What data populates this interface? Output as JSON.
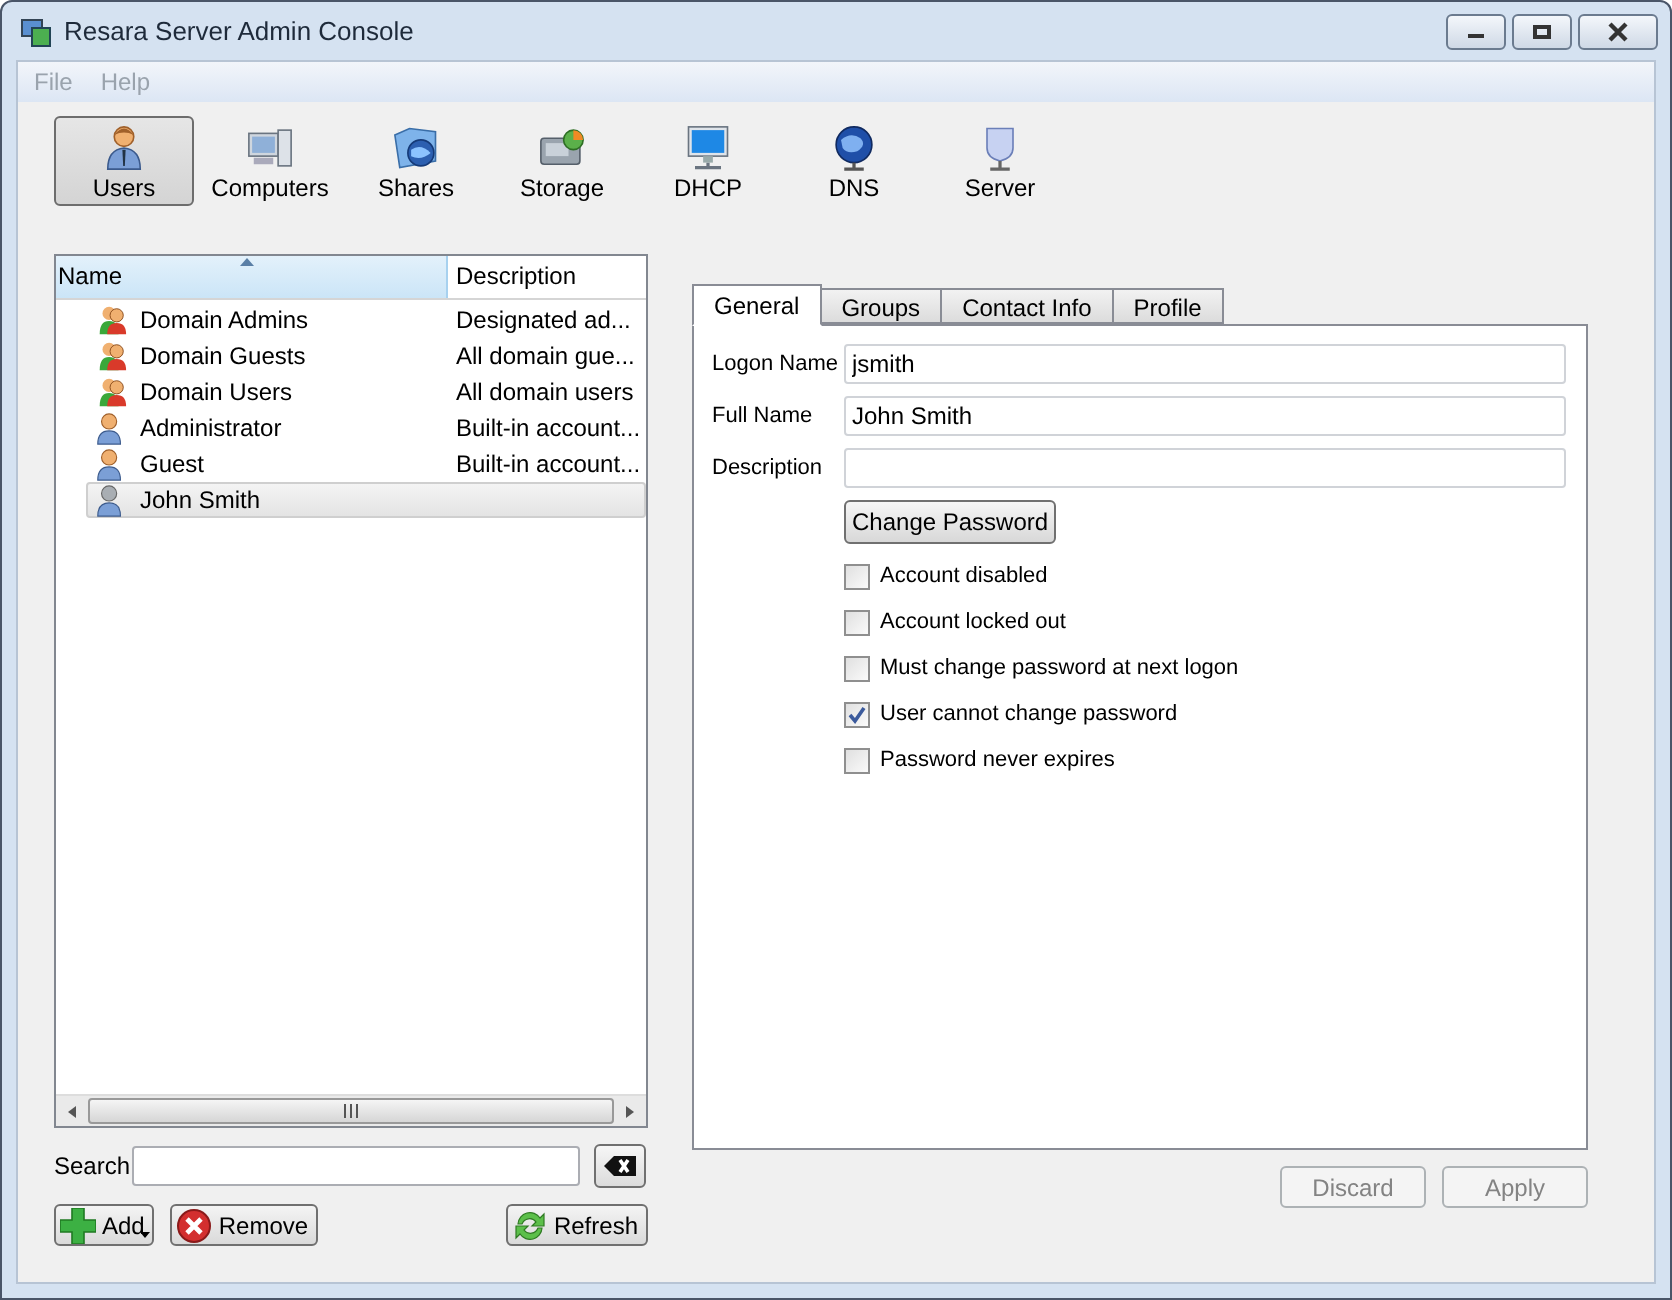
{
  "window": {
    "title": "Resara Server Admin Console"
  },
  "menu": [
    {
      "label": "File",
      "disabled": true
    },
    {
      "label": "Help",
      "disabled": true
    }
  ],
  "toolbar": [
    {
      "label": "Users",
      "kind": "users",
      "selected": true
    },
    {
      "label": "Computers",
      "kind": "computers",
      "selected": false
    },
    {
      "label": "Shares",
      "kind": "shares",
      "selected": false
    },
    {
      "label": "Storage",
      "kind": "storage",
      "selected": false
    },
    {
      "label": "DHCP",
      "kind": "dhcp",
      "selected": false
    },
    {
      "label": "DNS",
      "kind": "dns",
      "selected": false
    },
    {
      "label": "Server",
      "kind": "server",
      "selected": false
    }
  ],
  "list": {
    "columns": [
      "Name",
      "Description"
    ],
    "rows": [
      {
        "name": "Domain Admins",
        "description": "Designated ad...",
        "kind": "group",
        "selected": false
      },
      {
        "name": "Domain Guests",
        "description": "All domain gue...",
        "kind": "group",
        "selected": false
      },
      {
        "name": "Domain Users",
        "description": "All domain users",
        "kind": "group",
        "selected": false
      },
      {
        "name": "Administrator",
        "description": "Built-in account...",
        "kind": "user",
        "selected": false
      },
      {
        "name": "Guest",
        "description": "Built-in account...",
        "kind": "user",
        "selected": false
      },
      {
        "name": "John Smith",
        "kind": "user",
        "selected": true
      }
    ]
  },
  "search": {
    "label": "Search"
  },
  "list_buttons": [
    {
      "label": "Add",
      "kind": "add",
      "dropdown": true
    },
    {
      "label": "Remove",
      "kind": "remove",
      "dropdown": false
    },
    {
      "label": "Refresh",
      "kind": "refresh",
      "dropdown": false
    }
  ],
  "tabs": [
    {
      "label": "General",
      "selected": true
    },
    {
      "label": "Groups",
      "selected": false
    },
    {
      "label": "Contact Info",
      "selected": false
    },
    {
      "label": "Profile",
      "selected": false
    }
  ],
  "form": {
    "fields": [
      {
        "label": "Logon Name",
        "value": "jsmith"
      },
      {
        "label": "Full Name",
        "value": "John Smith"
      },
      {
        "label": "Description"
      }
    ],
    "change_password": "Change Password",
    "options": [
      {
        "label": "Account disabled",
        "checked": false
      },
      {
        "label": "Account locked out",
        "checked": false
      },
      {
        "label": "Must change password at next logon",
        "checked": false
      },
      {
        "label": "User cannot change password",
        "checked": true
      },
      {
        "label": "Password never expires",
        "checked": false
      }
    ]
  },
  "actions": [
    {
      "label": "Discard",
      "disabled": true
    },
    {
      "label": "Apply",
      "disabled": true
    }
  ]
}
